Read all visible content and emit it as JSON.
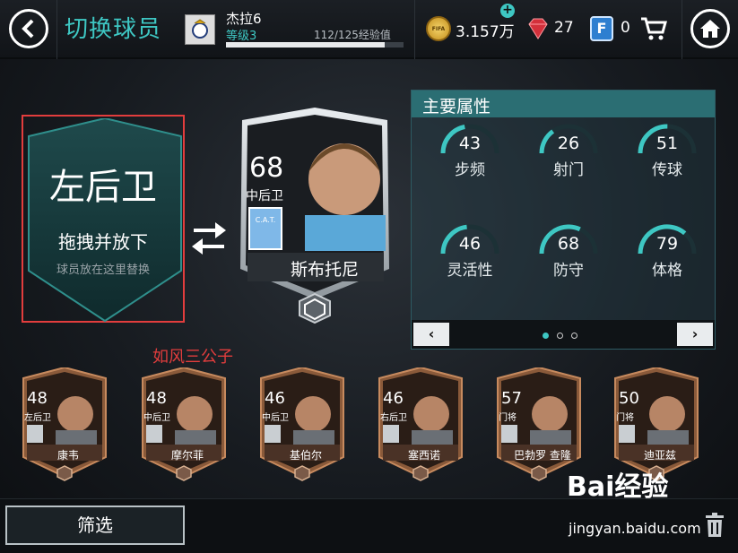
{
  "header": {
    "title": "切换球员",
    "player_name": "杰拉6",
    "level_label": "等级",
    "level": "3",
    "xp_text": "112/125经验值",
    "xp_fraction": 0.896,
    "coins": "3.157万",
    "gems": "27",
    "fifa_points": "0",
    "coin_label": "FIFA",
    "fpts_letter": "F"
  },
  "drop_zone": {
    "position": "左后卫",
    "action": "拖拽并放下",
    "hint": "球员放在这里替换"
  },
  "selected_player": {
    "rating": "68",
    "position": "中后卫",
    "name": "斯布托尼",
    "club_badge_text": "C.A.T."
  },
  "attributes": {
    "title": "主要属性",
    "stats": [
      {
        "value": "43",
        "label": "步频"
      },
      {
        "value": "26",
        "label": "射门"
      },
      {
        "value": "51",
        "label": "传球"
      },
      {
        "value": "46",
        "label": "灵活性"
      },
      {
        "value": "68",
        "label": "防守"
      },
      {
        "value": "79",
        "label": "体格"
      }
    ],
    "prev": "‹",
    "next": "›",
    "page_count": 3,
    "active_page": 1
  },
  "watermark": "如风三公子",
  "bench": [
    {
      "rating": "48",
      "position": "左后卫",
      "name": "康韦"
    },
    {
      "rating": "48",
      "position": "中后卫",
      "name": "摩尔菲"
    },
    {
      "rating": "46",
      "position": "中后卫",
      "name": "基伯尔"
    },
    {
      "rating": "46",
      "position": "右后卫",
      "name": "塞西诺"
    },
    {
      "rating": "57",
      "position": "门将",
      "name": "巴勃罗 查隆"
    },
    {
      "rating": "50",
      "position": "门将",
      "name": "迪亚兹"
    }
  ],
  "footer": {
    "filter_label": "筛选",
    "baidu_logo": "Bai经验",
    "baidu_url": "jingyan.baidu.com"
  },
  "colors": {
    "accent": "#3ec7c3",
    "highlight_border": "#e23d3d",
    "card_bronze": "#8a5a3a",
    "card_silver": "#c9ced2"
  }
}
